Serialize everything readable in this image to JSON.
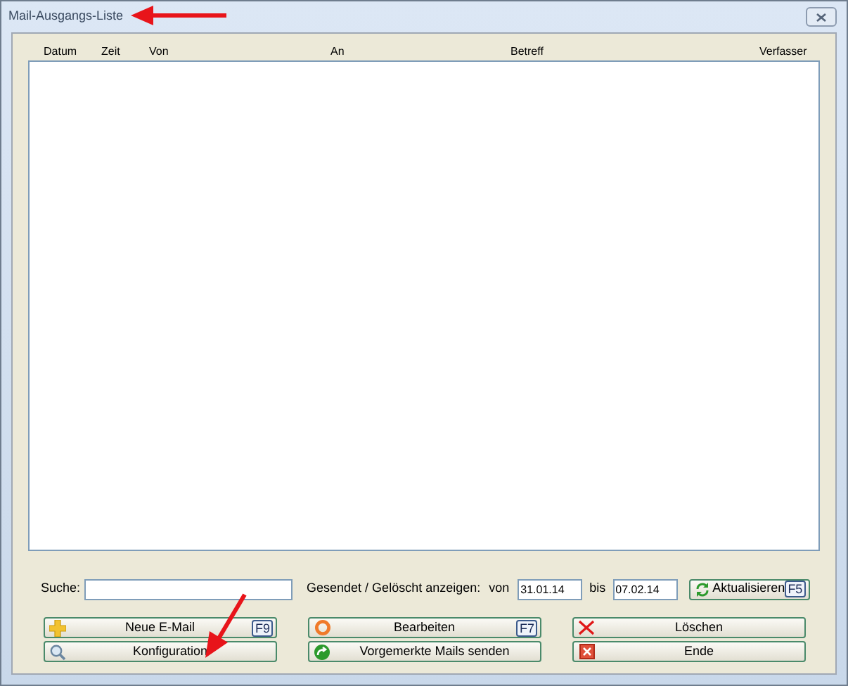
{
  "window": {
    "title": "Mail-Ausgangs-Liste"
  },
  "table": {
    "columns": [
      "Datum",
      "Zeit",
      "Von",
      "An",
      "Betreff",
      "Verfasser"
    ]
  },
  "filter": {
    "search_label": "Suche:",
    "range_label": "Gesendet / Gelöscht anzeigen:",
    "from_label": "von",
    "from_value": "31.01.14",
    "to_label": "bis",
    "to_value": "07.02.14"
  },
  "refresh_button": {
    "label": "Aktualisieren",
    "shortcut": "F5"
  },
  "buttons": [
    {
      "label": "Neue E-Mail",
      "shortcut": "F9"
    },
    {
      "label": "Bearbeiten",
      "shortcut": "F7"
    },
    {
      "label": "Löschen"
    },
    {
      "label": "Konfiguration"
    },
    {
      "label": "Vorgemerkte Mails senden"
    },
    {
      "label": "Ende"
    }
  ]
}
